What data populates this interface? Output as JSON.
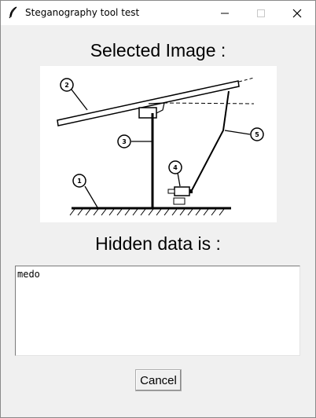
{
  "window": {
    "title": "Steganography tool test",
    "icon": "feather-icon"
  },
  "labels": {
    "selected_image": "Selected Image :",
    "hidden_data": "Hidden data is :"
  },
  "figure": {
    "callouts": [
      "1",
      "2",
      "3",
      "4",
      "5"
    ]
  },
  "hidden_text": {
    "value": "medo"
  },
  "buttons": {
    "cancel": "Cancel"
  }
}
